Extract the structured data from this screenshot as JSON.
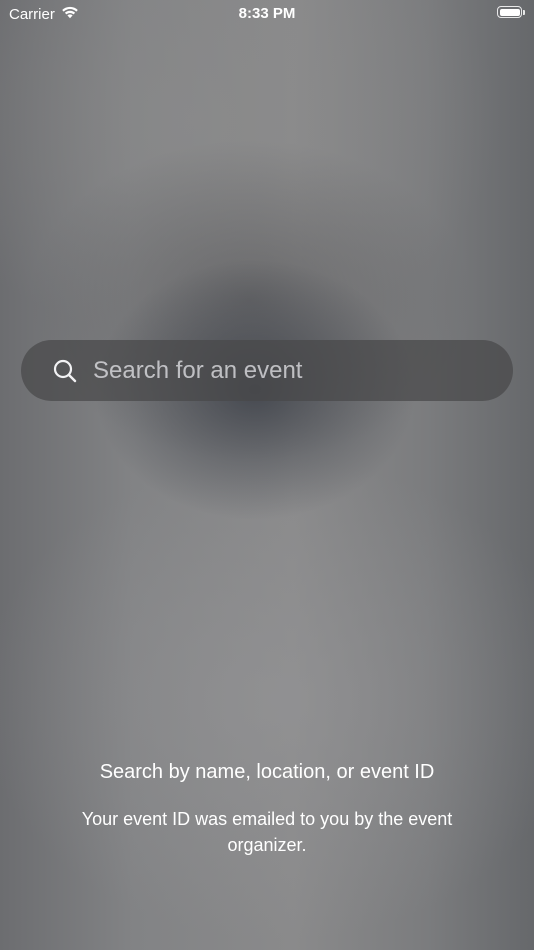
{
  "status_bar": {
    "carrier": "Carrier",
    "time": "8:33 PM",
    "wifi_icon": "wifi-icon",
    "battery_icon": "battery-icon"
  },
  "search": {
    "placeholder": "Search for an event",
    "value": "",
    "icon": "search-icon"
  },
  "hint": {
    "title": "Search by name, location, or event ID",
    "subtitle": "Your event ID was emailed to you by the event organizer."
  },
  "colors": {
    "text": "#ffffff",
    "search_bar_bg": "#48484a",
    "placeholder": "#ebebf0"
  }
}
